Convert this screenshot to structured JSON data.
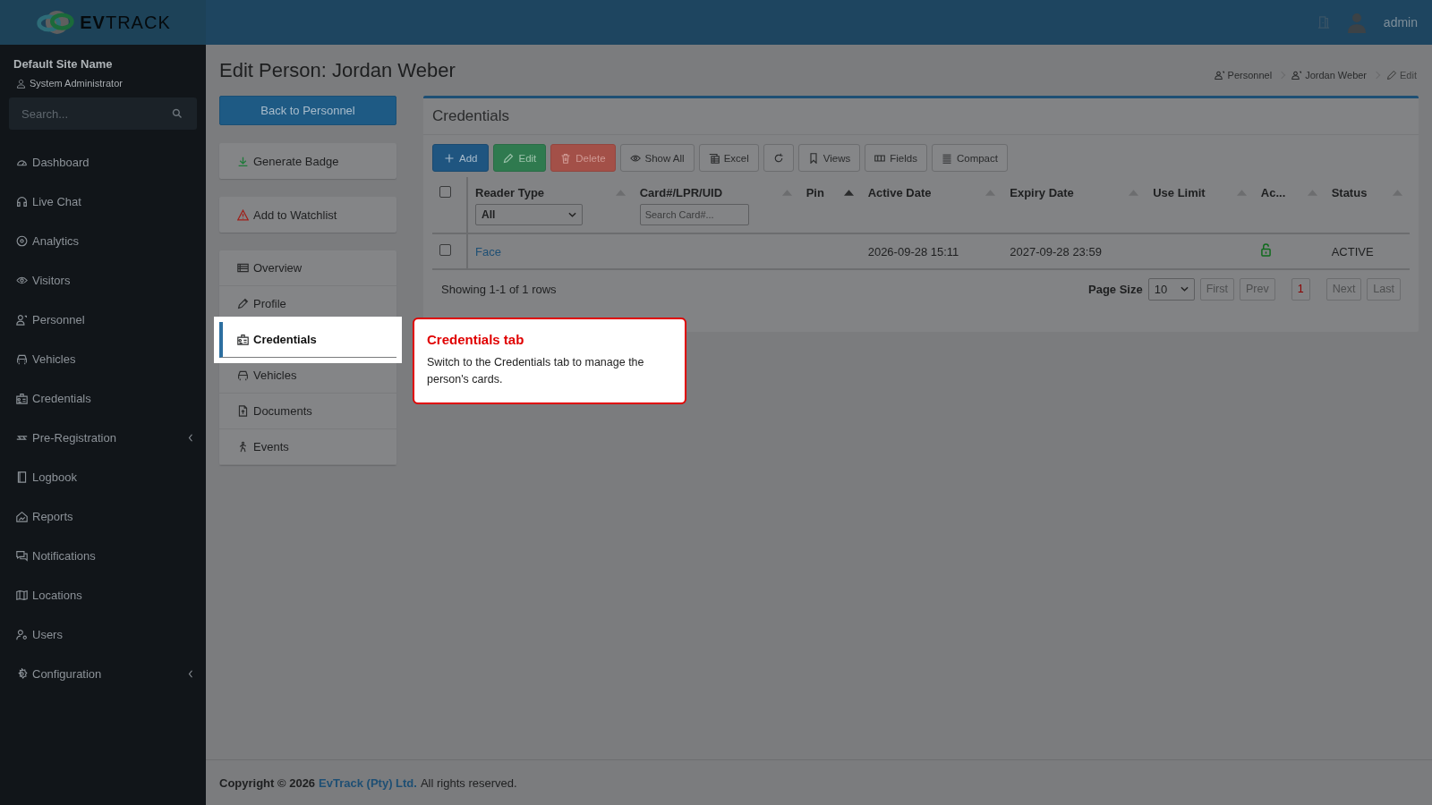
{
  "brand": {
    "logo_text": "**EV**TRACK"
  },
  "topbar": {
    "user": "admin"
  },
  "sidebar": {
    "site_name": "Default Site Name",
    "role": "System Administrator",
    "search_placeholder": "Search...",
    "items": [
      {
        "label": "Dashboard",
        "expandable": false
      },
      {
        "label": "Live Chat",
        "expandable": false
      },
      {
        "label": "Analytics",
        "expandable": false
      },
      {
        "label": "Visitors",
        "expandable": false
      },
      {
        "label": "Personnel",
        "expandable": false
      },
      {
        "label": "Vehicles",
        "expandable": false
      },
      {
        "label": "Credentials",
        "expandable": false
      },
      {
        "label": "Pre-Registration",
        "expandable": true
      },
      {
        "label": "Logbook",
        "expandable": false
      },
      {
        "label": "Reports",
        "expandable": false
      },
      {
        "label": "Notifications",
        "expandable": false
      },
      {
        "label": "Locations",
        "expandable": false
      },
      {
        "label": "Users",
        "expandable": false
      },
      {
        "label": "Configuration",
        "expandable": true
      }
    ]
  },
  "page": {
    "title": "Edit Person: Jordan Weber",
    "breadcrumb": [
      {
        "label": "Personnel"
      },
      {
        "label": "Jordan Weber"
      },
      {
        "label": "Edit"
      }
    ],
    "back_button": "Back to Personnel",
    "actions": [
      {
        "label": "Generate Badge"
      },
      {
        "label": "Add to Watchlist"
      }
    ],
    "tabs": [
      {
        "label": "Overview",
        "selected": false
      },
      {
        "label": "Profile",
        "selected": false
      },
      {
        "label": "Credentials",
        "selected": true
      },
      {
        "label": "Vehicles",
        "selected": false
      },
      {
        "label": "Documents",
        "selected": false
      },
      {
        "label": "Events",
        "selected": false
      }
    ]
  },
  "panel": {
    "title": "Credentials",
    "toolbar": [
      {
        "kind": "primary",
        "label": "Add"
      },
      {
        "kind": "success",
        "label": "Edit"
      },
      {
        "kind": "danger",
        "label": "Delete"
      },
      {
        "kind": "default",
        "label": "Show All"
      },
      {
        "kind": "default",
        "label": "Excel"
      },
      {
        "kind": "default"
      },
      {
        "kind": "default",
        "label": "Views"
      },
      {
        "kind": "default",
        "label": "Fields"
      },
      {
        "kind": "default",
        "label": "Compact"
      }
    ],
    "select_all_checked": false,
    "columns": [
      {
        "label": "Reader Type",
        "sorted": false,
        "filter": {
          "kind": "select",
          "value": "All"
        }
      },
      {
        "label": "Card#/LPR/UID",
        "sorted": false,
        "filter": {
          "kind": "input",
          "placeholder": "Search Card#..."
        }
      },
      {
        "label": "Pin",
        "sorted": true
      },
      {
        "label": "Active Date",
        "sorted": false
      },
      {
        "label": "Expiry Date",
        "sorted": false
      },
      {
        "label": "Use Limit",
        "sorted": false
      },
      {
        "label": "Ac...",
        "sorted": false
      },
      {
        "label": "Status",
        "sorted": false
      }
    ],
    "rows": [
      {
        "checked": false,
        "reader_type": "Face",
        "card": "",
        "pin": "",
        "active_date": "2026-09-28 15:11",
        "expiry_date": "2027-09-28 23:59",
        "use_limit": "",
        "locked": false,
        "status": "ACTIVE"
      }
    ],
    "summary": "Showing 1-1 of 1 rows",
    "page_size_label": "Page Size",
    "page_size": "10",
    "pages": [
      {
        "label": "First",
        "kind": "nav",
        "disabled": true
      },
      {
        "label": "Prev",
        "kind": "nav",
        "disabled": true
      },
      {
        "label": "1",
        "kind": "page",
        "selected": true
      },
      {
        "label": "Next",
        "kind": "nav",
        "disabled": true
      },
      {
        "label": "Last",
        "kind": "nav",
        "disabled": true
      }
    ]
  },
  "tour": {
    "title": "Credentials tab",
    "text": "Switch to the Credentials tab to manage the person's cards."
  },
  "footer": {
    "prefix": "Copyright © 2026",
    "company": "EvTrack (Pty) Ltd.",
    "suffix": "All rights reserved."
  }
}
